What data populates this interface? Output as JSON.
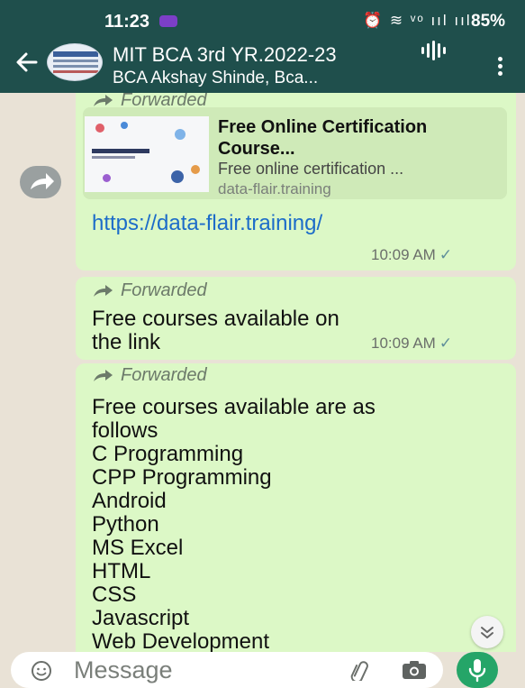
{
  "status_bar": {
    "time": "11:23",
    "signal_icons": "⏰ ≋ ᵛᵒ ııl ııl",
    "battery": "85%"
  },
  "header": {
    "title": "MIT BCA 3rd YR.2022-23",
    "subtitle": "BCA Akshay Shinde, Bca...",
    "icons": [
      "back-arrow-icon",
      "group-avatar",
      "voice-chat-icon",
      "more-options-icon"
    ]
  },
  "messages": [
    {
      "forwarded_label": "Forwarded",
      "preview": {
        "title": "Free Online Certification Course...",
        "description": "Free online certification ...",
        "domain": "data-flair.training"
      },
      "link": "https://data-flair.training/",
      "time": "10:09 AM",
      "tick": "✓"
    },
    {
      "forwarded_label": "Forwarded",
      "text_lines": [
        "Free courses  available on",
        "the link"
      ],
      "time": "10:09 AM",
      "tick": "✓"
    },
    {
      "forwarded_label": "Forwarded",
      "text_lines": [
        "Free courses available are as",
        "follows",
        "C Programming",
        "CPP Programming",
        "Android",
        "Python",
        "MS Excel",
        "HTML",
        "CSS",
        "Javascript",
        "Web Development"
      ]
    }
  ],
  "composer": {
    "placeholder": "Message"
  },
  "colors": {
    "header": "#1f4f4c",
    "bubble": "#dcf8c6",
    "link": "#1c6cc9",
    "mic": "#25a568",
    "chat_bg": "#e9e2d6"
  }
}
